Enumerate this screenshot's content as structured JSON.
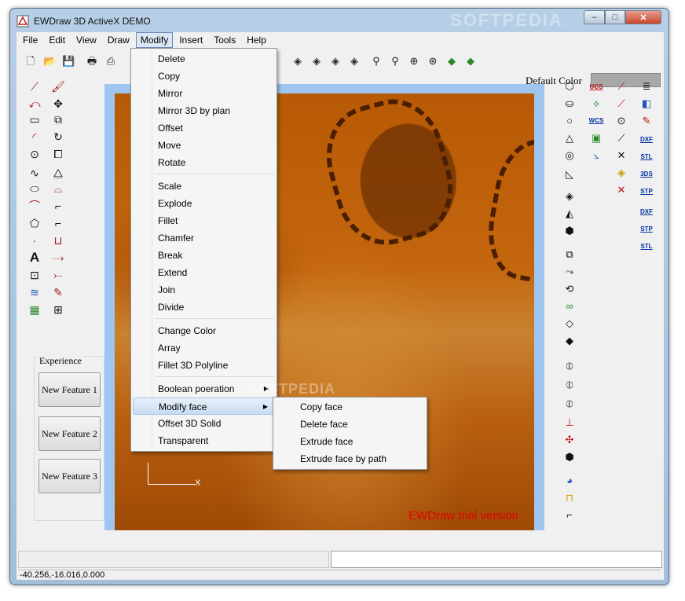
{
  "window": {
    "title": "EWDraw 3D ActiveX DEMO",
    "watermark": "SOFTPEDIA",
    "minimize_glyph": "–",
    "maximize_glyph": "□",
    "close_glyph": "✕"
  },
  "menubar": {
    "items": [
      "File",
      "Edit",
      "View",
      "Draw",
      "Modify",
      "Insert",
      "Tools",
      "Help"
    ],
    "active": "Modify"
  },
  "toolbar": {
    "default_color_label": "Default Color",
    "default_color_value": "#a8a8a8"
  },
  "modify_menu": {
    "items": [
      "Delete",
      "Copy",
      "Mirror",
      "Mirror 3D by plan",
      "Offset",
      "Move",
      "Rotate",
      "Scale",
      "Explode",
      "Fillet",
      "Chamfer",
      "Break",
      "Extend",
      "Join",
      "Divide",
      "Change Color",
      "Array",
      "Fillet 3D Polyline",
      "Boolean poeration",
      "Modify face",
      "Offset 3D Solid",
      "Transparent"
    ],
    "highlighted": "Modify face"
  },
  "modify_face_submenu": {
    "items": [
      "Copy face",
      "Delete face",
      "Extrude face",
      "Extrude face by path"
    ]
  },
  "experience": {
    "label": "Experience",
    "buttons": [
      "New Feature 1",
      "New Feature 2",
      "New Feature 3"
    ]
  },
  "viewport": {
    "trial_text": "EWDraw trial version",
    "axis_x_label": "X",
    "watermark": "SOFTPEDIA"
  },
  "right_toolbar": {
    "ucs_label": "UCS",
    "wcs_label": "WCS",
    "export_labels": [
      "DXF",
      "STL",
      "3DS",
      "STP",
      "DXF",
      "STP",
      "STL"
    ]
  },
  "status": {
    "coordinates": "-40.256,-16.016,0.000"
  },
  "colors": {
    "accent_trial": "#e00000",
    "menu_highlight": "#c8dcf4",
    "viewport_bg": "#9fc6f0"
  }
}
